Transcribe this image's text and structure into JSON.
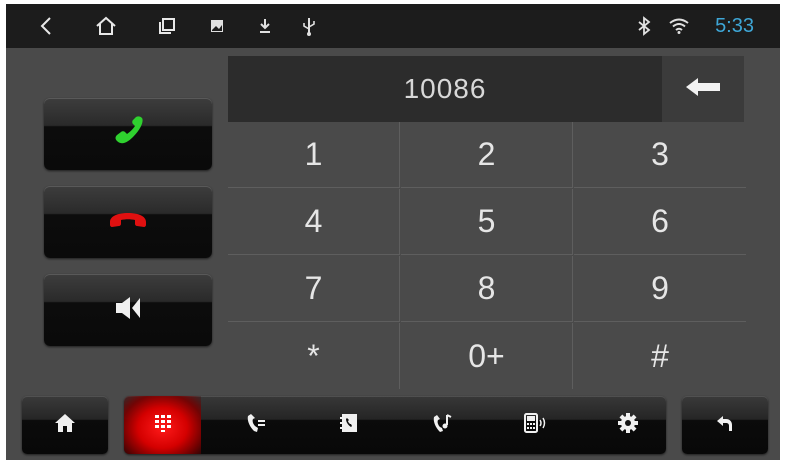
{
  "status_bar": {
    "icons": [
      "back-icon",
      "home-icon",
      "recents-icon",
      "image-notification-icon",
      "download-icon",
      "usb-icon"
    ],
    "right_icons": [
      "bluetooth-icon",
      "wifi-icon"
    ],
    "time": "5:33",
    "time_color": "#3ea6d6"
  },
  "dialer": {
    "number": "10086",
    "backspace_icon": "backspace-arrow-icon",
    "call_button_icon": "phone-call-icon",
    "call_color": "#2fd12f",
    "hangup_button_icon": "phone-hangup-icon",
    "hangup_color": "#e01010",
    "speaker_button_icon": "speaker-icon"
  },
  "keypad": {
    "keys": [
      "1",
      "2",
      "3",
      "4",
      "5",
      "6",
      "7",
      "8",
      "9",
      "*",
      "0+",
      "#"
    ]
  },
  "bottom_bar": {
    "home_icon": "home-icon",
    "back_icon": "return-icon",
    "tabs": [
      {
        "icon": "dialpad-icon",
        "active": true
      },
      {
        "icon": "call-log-icon",
        "active": false
      },
      {
        "icon": "contacts-icon",
        "active": false
      },
      {
        "icon": "call-music-icon",
        "active": false
      },
      {
        "icon": "phone-device-icon",
        "active": false
      },
      {
        "icon": "settings-gear-icon",
        "active": false
      }
    ],
    "active_color": "#e00000"
  }
}
